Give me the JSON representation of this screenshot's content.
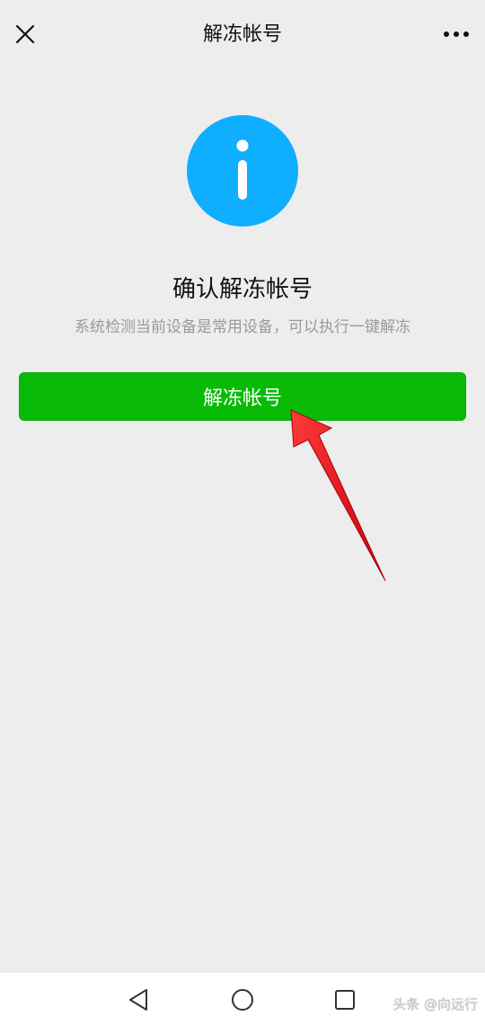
{
  "header": {
    "title": "解冻帐号",
    "close_icon": "close-icon",
    "more_icon": "more-icon"
  },
  "main": {
    "icon": "info-icon",
    "icon_color": "#10aeff",
    "heading": "确认解冻帐号",
    "description": "系统检测当前设备是常用设备，可以执行一键解冻",
    "button_label": "解冻帐号",
    "button_color": "#09bb07"
  },
  "annotation": {
    "arrow_color": "#e8141a"
  },
  "navbar": {
    "back_icon": "back-triangle-icon",
    "home_icon": "home-circle-icon",
    "recent_icon": "recent-square-icon"
  },
  "watermark": {
    "text": "头条 @向远行"
  }
}
